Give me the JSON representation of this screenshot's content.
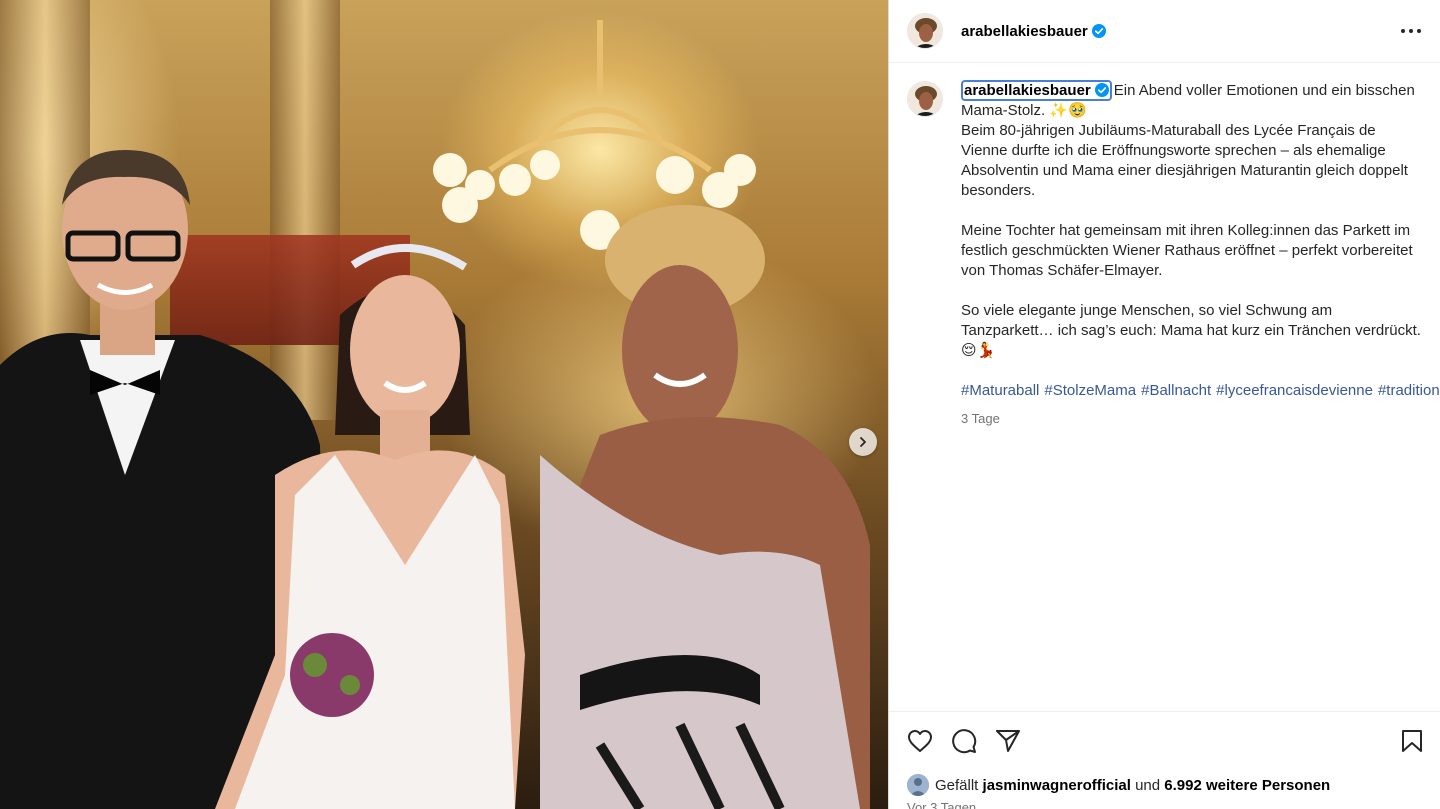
{
  "post": {
    "username": "arabellakiesbauer",
    "caption_lines_1": [
      "Ein Abend voller Emotionen und ein bisschen Mama-Stolz. ✨🥹",
      "Beim 80-jährigen Jubiläums-Maturaball des Lycée Français de Vienne durfte ich die Eröffnungsworte sprechen – als ehemalige Absolventin und Mama einer diesjährigen Maturantin gleich doppelt besonders."
    ],
    "caption_para_2": "Meine Tochter hat gemeinsam mit ihren Kolleg:innen das Parkett im festlich geschmückten Wiener Rathaus eröffnet – perfekt vorbereitet von Thomas Schäfer-Elmayer.",
    "caption_para_3": "So viele elegante junge Menschen, so viel Schwung am Tanzparkett… ich sag’s euch: Mama hat kurz ein Tränchen verdrückt. 😌💃",
    "hashtags": [
      "#Maturaball",
      "#StolzeMama",
      "#Ballnacht",
      "#lyceefrancaisdevienne",
      "#tradition"
    ],
    "caption_time": "3 Tage",
    "likes": {
      "prefix": "Gefällt",
      "liker": "jasminwagnerofficial",
      "middle": "und",
      "count_text": "6.992 weitere Personen"
    },
    "posted_time": "Vor 3 Tagen"
  },
  "icons": {
    "more": "more-horizontal-icon",
    "like": "heart-icon",
    "comment": "comment-icon",
    "share": "send-icon",
    "save": "bookmark-icon",
    "verified": "verified-badge-icon",
    "next": "chevron-right-icon"
  },
  "colors": {
    "verified": "#0095f6",
    "hashtag": "#385898",
    "secondary_text": "#737373"
  }
}
